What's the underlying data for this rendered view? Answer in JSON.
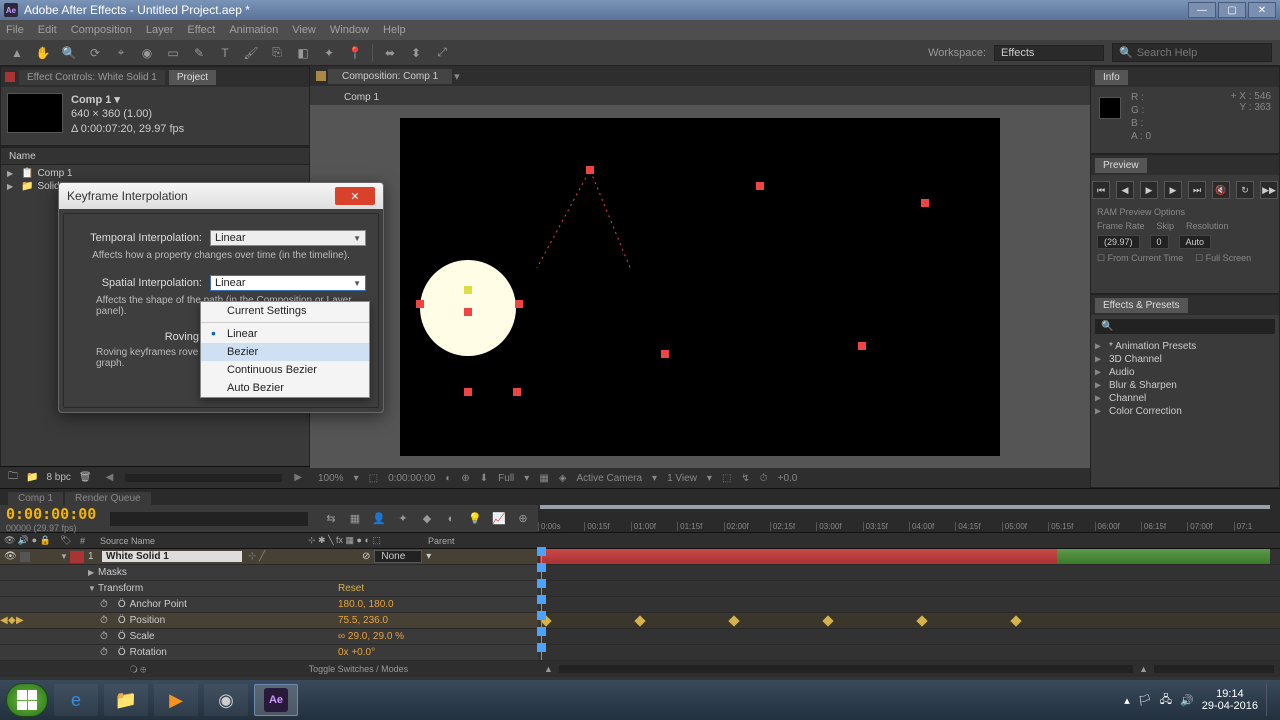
{
  "window": {
    "title": "Adobe After Effects - Untitled Project.aep *"
  },
  "menu": [
    "File",
    "Edit",
    "Composition",
    "Layer",
    "Effect",
    "Animation",
    "View",
    "Window",
    "Help"
  ],
  "workspace": {
    "label": "Workspace:",
    "value": "Effects"
  },
  "search_help_placeholder": "Search Help",
  "project": {
    "tab1": "Project",
    "tab2": "Effect Controls: White Solid 1",
    "comp_name": "Comp 1 ▾",
    "comp_dims": "640 × 360 (1.00)",
    "comp_dur": "Δ 0:00:07:20, 29.97 fps",
    "col_name": "Name",
    "items": [
      "Comp 1",
      "Solids"
    ],
    "bpc": "8 bpc"
  },
  "composition": {
    "tab": "Composition: Comp 1",
    "subtab": "Comp 1",
    "footer": {
      "zoom": "100%",
      "time": "0:00:00:00",
      "res": "Full",
      "camera": "Active Camera",
      "view": "1 View",
      "exp": "+0.0"
    }
  },
  "info": {
    "R": "R :",
    "G": "G :",
    "B": "B :",
    "A": "A : 0",
    "X": "X : 546",
    "Y": "Y : 363",
    "tab": "Info"
  },
  "preview": {
    "tab": "Preview",
    "ram": "RAM Preview Options",
    "labels": [
      "Frame Rate",
      "Skip",
      "Resolution"
    ],
    "vals": [
      "(29.97)",
      "0",
      "Auto"
    ],
    "from": "From Current Time",
    "full": "Full Screen"
  },
  "effects": {
    "tab": "Effects & Presets",
    "items": [
      "* Animation Presets",
      "3D Channel",
      "Audio",
      "Blur & Sharpen",
      "Channel",
      "Color Correction"
    ]
  },
  "dialog": {
    "title": "Keyframe Interpolation",
    "temporal_label": "Temporal Interpolation:",
    "temporal_value": "Linear",
    "temporal_hint": "Affects how a property changes over time (in the timeline).",
    "spatial_label": "Spatial Interpolation:",
    "spatial_value": "Linear",
    "spatial_hint": "Affects the shape of the path (in the Composition or Layer panel).",
    "roving_label": "Roving:",
    "roving_hint": "Roving keyframes rove in time to smooth out the speed graph.",
    "options": [
      "Current Settings",
      "Linear",
      "Bezier",
      "Continuous Bezier",
      "Auto Bezier"
    ],
    "selected": 1,
    "hover": 2
  },
  "timeline": {
    "tabs": [
      "Comp 1",
      "Render Queue"
    ],
    "time": "0:00:00:00",
    "time_sub": "00000 (29.97 fps)",
    "ruler": [
      "0:00s",
      "00:15f",
      "01:00f",
      "01:15f",
      "02:00f",
      "02:15f",
      "03:00f",
      "03:15f",
      "04:00f",
      "04:15f",
      "05:00f",
      "05:15f",
      "06:00f",
      "06:15f",
      "07:00f",
      "07:1"
    ],
    "col_source": "Source Name",
    "col_parent": "Parent",
    "layer": {
      "index": "1",
      "name": "White Solid 1",
      "parent": "None",
      "masks": "Masks",
      "transform": "Transform",
      "reset": "Reset",
      "props": [
        {
          "name": "Anchor Point",
          "value": "180.0, 180.0"
        },
        {
          "name": "Position",
          "value": "75.5, 236.0"
        },
        {
          "name": "Scale",
          "value": "∞ 29.0, 29.0 %"
        },
        {
          "name": "Rotation",
          "value": "0x +0.0°"
        }
      ]
    },
    "toggle": "Toggle Switches / Modes"
  },
  "taskbar": {
    "time": "19:14",
    "date": "29-04-2016"
  }
}
